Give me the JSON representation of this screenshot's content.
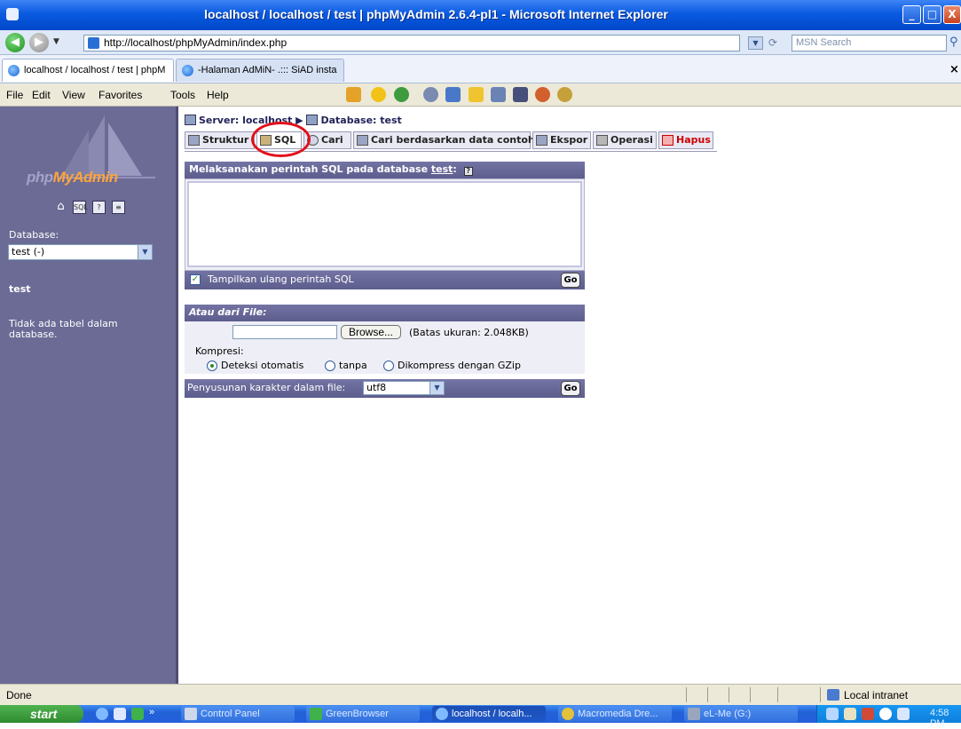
{
  "window": {
    "title": "localhost / localhost / test | phpMyAdmin 2.6.4-pl1 - Microsoft Internet Explorer",
    "minimize": "_",
    "maximize": "□",
    "close": "X"
  },
  "browser": {
    "back_glyph": "◀",
    "forward_glyph": "▶",
    "address": "http://localhost/phpMyAdmin/index.php",
    "search_placeholder": "MSN Search",
    "tabs": [
      {
        "label": "localhost / localhost / test | phpM"
      },
      {
        "label": "-Halaman AdMiN- .::: SiAD insta"
      }
    ],
    "tab_close": "×",
    "menu": [
      "File",
      "Edit",
      "View",
      "Favorites",
      "Tools",
      "Help"
    ]
  },
  "sidebar": {
    "logo_php": "php",
    "logo_myadmin": "MyAdmin",
    "icons": [
      "home-icon",
      "sql-icon",
      "help-icon",
      "docs-icon"
    ],
    "database_label": "Database:",
    "database_selected": "test (-)",
    "db_name": "test",
    "no_tables": "Tidak ada tabel dalam database."
  },
  "main": {
    "breadcrumb": {
      "server": "Server: localhost",
      "separator": "▶",
      "database": "Database: test"
    },
    "tabs": [
      {
        "label": "Struktur"
      },
      {
        "label": "SQL"
      },
      {
        "label": "Cari"
      },
      {
        "label": "Cari berdasarkan data contoh"
      },
      {
        "label": "Ekspor"
      },
      {
        "label": "Operasi"
      },
      {
        "label": "Hapus"
      }
    ],
    "sql_panel": {
      "header_prefix": "Melaksanakan perintah SQL pada database ",
      "header_db": "test",
      "header_suffix": ":",
      "show_again_label": "Tampilkan ulang perintah SQL",
      "go": "Go"
    },
    "file_panel": {
      "header": "Atau dari File:",
      "browse": "Browse...",
      "size_limit": "(Batas ukuran: 2.048KB)",
      "compression_label": "Kompresi:",
      "options": [
        "Deteksi otomatis",
        "tanpa",
        "Dikompress dengan GZip"
      ],
      "selected_option": 0,
      "charset_label": "Penyusunan karakter dalam file:",
      "charset_value": "utf8",
      "go": "Go"
    }
  },
  "statusbar": {
    "text": "Done",
    "zone": "Local intranet"
  },
  "taskbar": {
    "start": "start",
    "overflow": "»",
    "buttons": [
      {
        "label": "Control Panel"
      },
      {
        "label": "GreenBrowser"
      },
      {
        "label": "localhost / localh..."
      },
      {
        "label": "Macromedia Dre..."
      },
      {
        "label": "eL-Me (G:)"
      }
    ],
    "clock": "4:58 PM"
  }
}
